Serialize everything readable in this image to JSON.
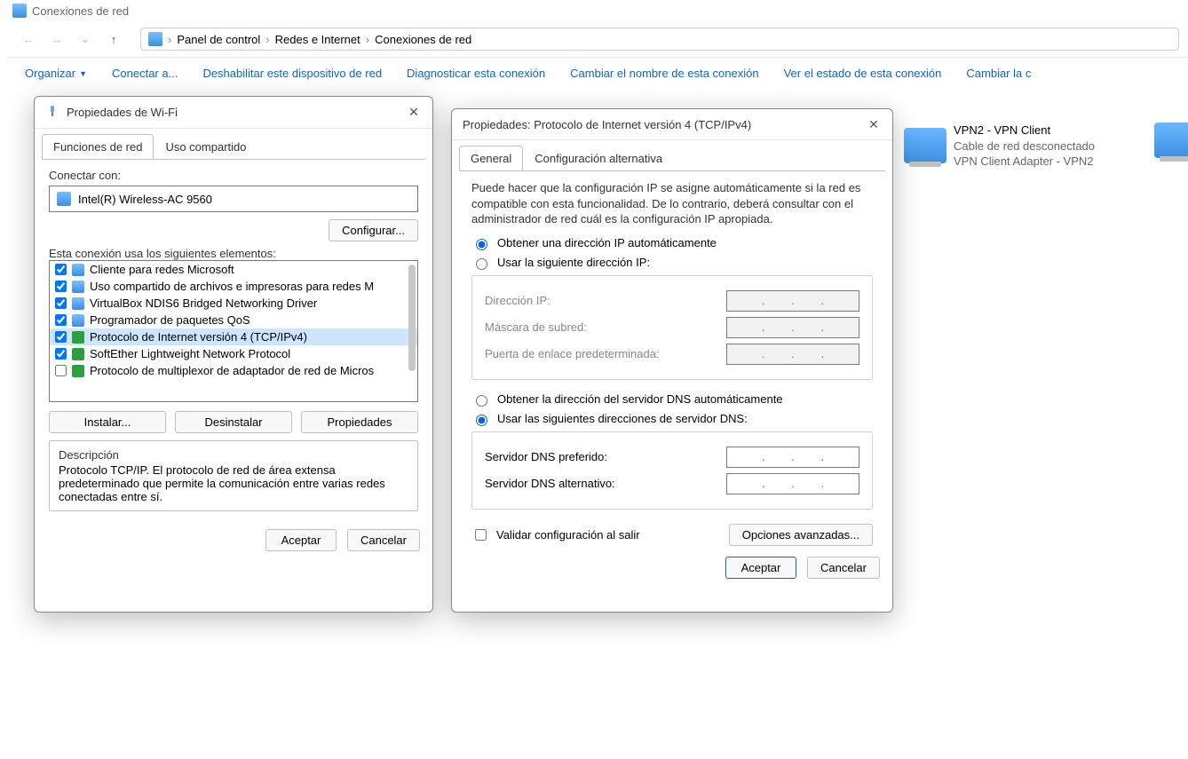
{
  "window": {
    "title": "Conexiones de red",
    "breadcrumb": [
      "Panel de control",
      "Redes e Internet",
      "Conexiones de red"
    ],
    "commands": {
      "organize": "Organizar",
      "connect": "Conectar a...",
      "disable": "Deshabilitar este dispositivo de red",
      "diagnose": "Diagnosticar esta conexión",
      "rename": "Cambiar el nombre de esta conexión",
      "status": "Ver el estado de esta conexión",
      "change": "Cambiar la c"
    }
  },
  "connections": [
    {
      "name": "VPN2 - VPN Client",
      "status": "Cable de red desconectado",
      "device": "VPN Client Adapter - VPN2"
    }
  ],
  "wifiDialog": {
    "title": "Propiedades de Wi-Fi",
    "tabs": {
      "functions": "Funciones de red",
      "sharing": "Uso compartido"
    },
    "connectWith": "Conectar con:",
    "adapter": "Intel(R) Wireless-AC 9560",
    "configure": "Configurar...",
    "usesElements": "Esta conexión usa los siguientes elementos:",
    "elements": [
      {
        "checked": true,
        "icon": "monitor",
        "label": "Cliente para redes Microsoft"
      },
      {
        "checked": true,
        "icon": "monitor",
        "label": "Uso compartido de archivos e impresoras para redes M"
      },
      {
        "checked": true,
        "icon": "monitor",
        "label": "VirtualBox NDIS6 Bridged Networking Driver"
      },
      {
        "checked": true,
        "icon": "monitor",
        "label": "Programador de paquetes QoS"
      },
      {
        "checked": true,
        "icon": "green",
        "label": "Protocolo de Internet versión 4 (TCP/IPv4)",
        "selected": true
      },
      {
        "checked": true,
        "icon": "green",
        "label": "SoftEther Lightweight Network Protocol"
      },
      {
        "checked": false,
        "icon": "green",
        "label": "Protocolo de multiplexor de adaptador de red de Micros"
      }
    ],
    "install": "Instalar...",
    "uninstall": "Desinstalar",
    "properties": "Propiedades",
    "descriptionTitle": "Descripción",
    "description": "Protocolo TCP/IP. El protocolo de red de área extensa predeterminado que permite la comunicación entre varias redes conectadas entre sí.",
    "accept": "Aceptar",
    "cancel": "Cancelar"
  },
  "ipv4Dialog": {
    "title": "Propiedades: Protocolo de Internet versión 4 (TCP/IPv4)",
    "tabs": {
      "general": "General",
      "alt": "Configuración alternativa"
    },
    "intro": "Puede hacer que la configuración IP se asigne automáticamente si la red es compatible con esta funcionalidad. De lo contrario, deberá consultar con el administrador de red cuál es la configuración IP apropiada.",
    "ipAuto": "Obtener una dirección IP automáticamente",
    "ipManual": "Usar la siguiente dirección IP:",
    "ipAddress": "Dirección IP:",
    "subnet": "Máscara de subred:",
    "gateway": "Puerta de enlace predeterminada:",
    "dnsAuto": "Obtener la dirección del servidor DNS automáticamente",
    "dnsManual": "Usar las siguientes direcciones de servidor DNS:",
    "dnsPref": "Servidor DNS preferido:",
    "dnsAlt": "Servidor DNS alternativo:",
    "validate": "Validar configuración al salir",
    "advanced": "Opciones avanzadas...",
    "accept": "Aceptar",
    "cancel": "Cancelar",
    "ipDots": ".        .        .",
    "state": {
      "ipMode": "auto",
      "dnsMode": "manual",
      "validate": false
    }
  }
}
